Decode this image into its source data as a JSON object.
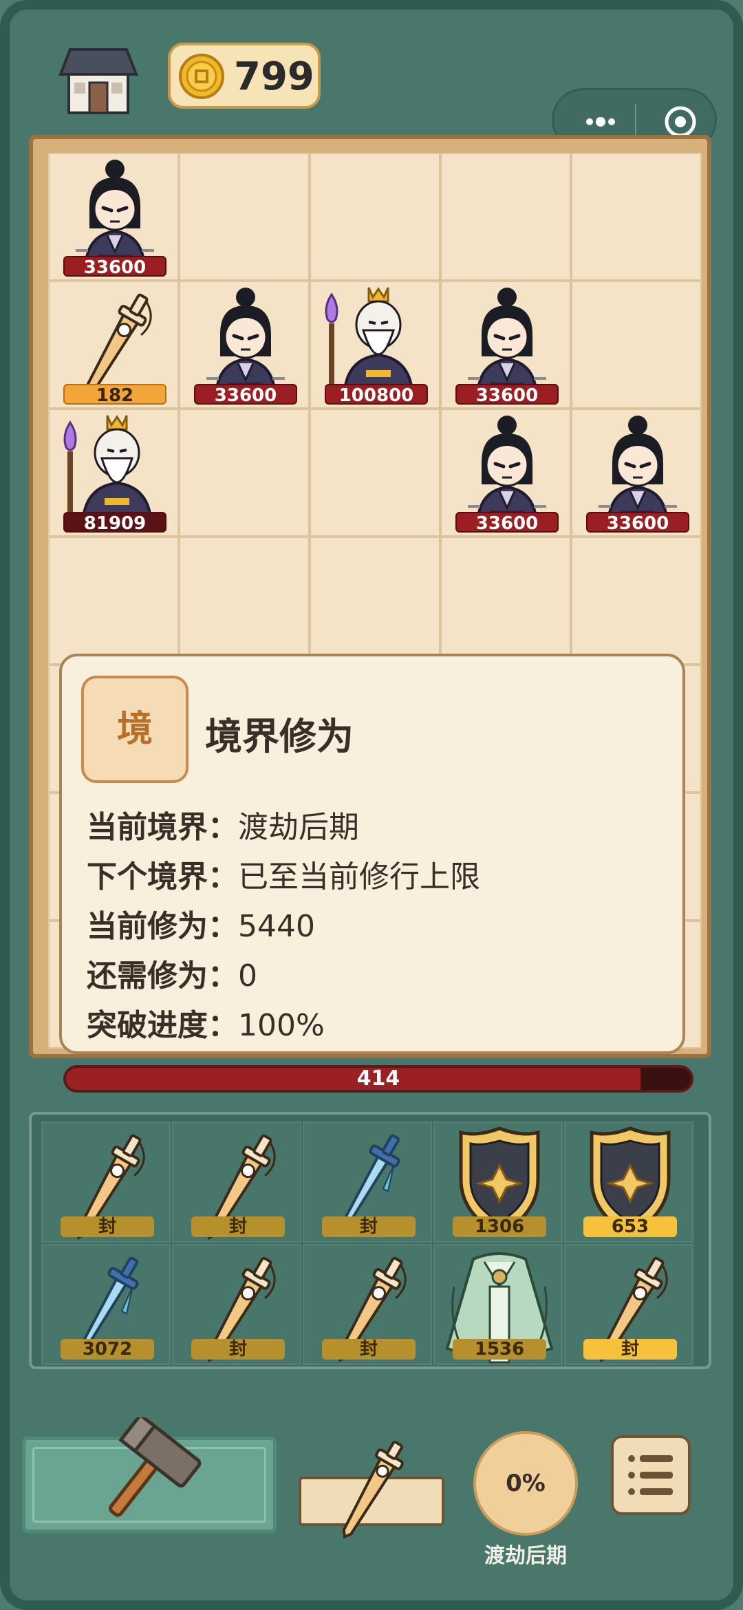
{
  "header": {
    "coins": "799"
  },
  "board": {
    "cells": [
      {
        "row": 0,
        "col": 0,
        "piece": "female-cultivator",
        "hp": "33600",
        "hp_style": "red"
      },
      {
        "row": 1,
        "col": 0,
        "piece": "taiji-sword",
        "hp": "182",
        "hp_style": "gold"
      },
      {
        "row": 1,
        "col": 1,
        "piece": "female-cultivator",
        "hp": "33600",
        "hp_style": "red"
      },
      {
        "row": 1,
        "col": 2,
        "piece": "elder-sage",
        "hp": "100800",
        "hp_style": "red"
      },
      {
        "row": 1,
        "col": 3,
        "piece": "female-cultivator",
        "hp": "33600",
        "hp_style": "red"
      },
      {
        "row": 2,
        "col": 0,
        "piece": "elder-sage",
        "hp": "81909",
        "hp_style": "dark"
      },
      {
        "row": 2,
        "col": 3,
        "piece": "female-cultivator",
        "hp": "33600",
        "hp_style": "red"
      },
      {
        "row": 2,
        "col": 4,
        "piece": "female-cultivator",
        "hp": "33600",
        "hp_style": "red"
      }
    ]
  },
  "popup": {
    "badge": "境",
    "title": "境界修为",
    "rows": [
      {
        "key": "当前境界：",
        "value": "渡劫后期"
      },
      {
        "key": "下个境界：",
        "value": "已至当前修行上限"
      },
      {
        "key": "当前修为：",
        "value": "5440"
      },
      {
        "key": "还需修为：",
        "value": "0"
      },
      {
        "key": "突破进度：",
        "value": "100%"
      }
    ]
  },
  "xpbar": {
    "value": "414",
    "fill_fraction": 0.92
  },
  "inventory": {
    "slots": [
      {
        "item": "taiji-sword",
        "tag": "封",
        "bright": false
      },
      {
        "item": "taiji-sword",
        "tag": "封",
        "bright": false
      },
      {
        "item": "blue-sword",
        "tag": "封",
        "bright": false
      },
      {
        "item": "gold-shield",
        "tag": "1306",
        "bright": false
      },
      {
        "item": "gold-shield",
        "tag": "653",
        "bright": true
      },
      {
        "item": "blue-sword",
        "tag": "3072",
        "bright": false
      },
      {
        "item": "taiji-sword",
        "tag": "封",
        "bright": false
      },
      {
        "item": "taiji-sword",
        "tag": "封",
        "bright": false
      },
      {
        "item": "jade-robe",
        "tag": "1536",
        "bright": false
      },
      {
        "item": "taiji-sword",
        "tag": "封",
        "bright": true
      }
    ]
  },
  "controls": {
    "progress": "0%",
    "realm": "渡劫后期"
  },
  "colors": {
    "background": "#4e7c70",
    "board": "#f2dfc0",
    "hp_red": "#9b1f22",
    "tag_gold": "#b7902e"
  }
}
